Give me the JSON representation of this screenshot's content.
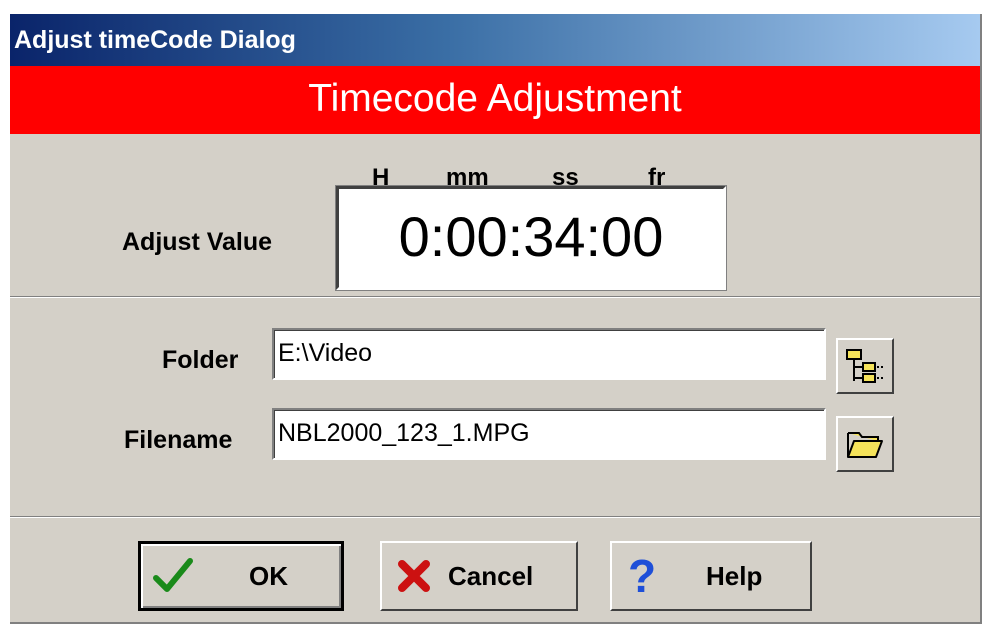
{
  "window": {
    "title": "Adjust timeCode Dialog"
  },
  "banner": {
    "text": "Timecode Adjustment"
  },
  "timecode": {
    "label": "Adjust Value",
    "headers": {
      "hours": "H",
      "minutes": "mm",
      "seconds": "ss",
      "frames": "fr"
    },
    "value": "0:00:34:00"
  },
  "files": {
    "folder_label": "Folder",
    "folder_value": "E:\\Video",
    "filename_label": "Filename",
    "filename_value": "NBL2000_123_1.MPG"
  },
  "buttons": {
    "ok": "OK",
    "cancel": "Cancel",
    "help": "Help"
  },
  "icons": {
    "folder_browse": "folder-tree-icon",
    "file_browse": "open-folder-icon",
    "ok": "checkmark-icon",
    "cancel": "x-icon",
    "help": "question-mark-icon"
  },
  "colors": {
    "banner": "#ff0000",
    "titlebar_start": "#0a246a",
    "titlebar_end": "#a6caf0",
    "dialog_face": "#d4d0c8",
    "check": "#1a8a1a",
    "cancel_x": "#cc1111",
    "help_q": "#1e4fd8",
    "folder_yellow": "#f5e35a"
  }
}
